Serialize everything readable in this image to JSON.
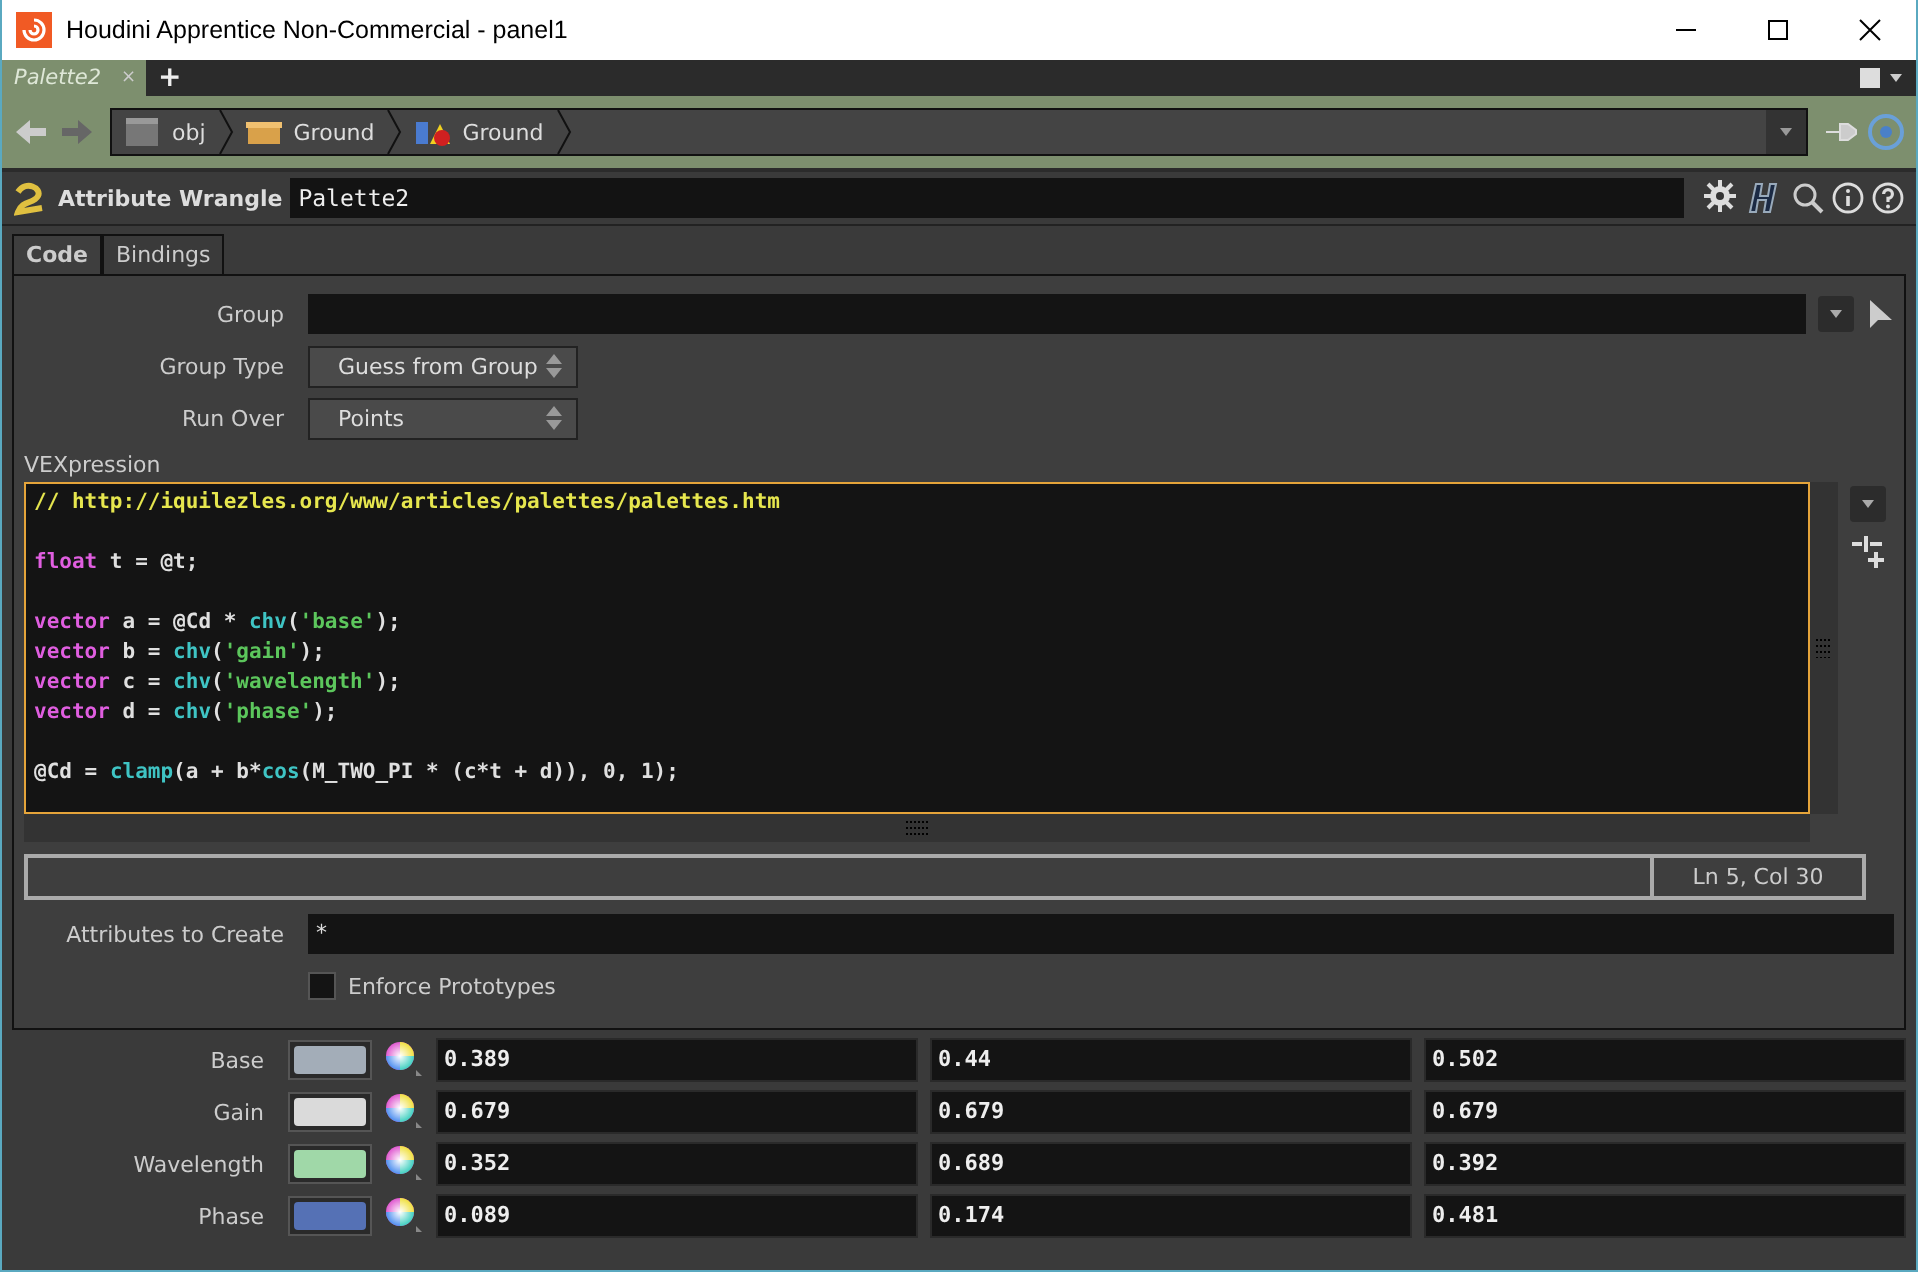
{
  "window": {
    "title": "Houdini Apprentice Non-Commercial - panel1"
  },
  "pane_tabs": [
    {
      "label": "Palette2",
      "selected": true,
      "close": "×"
    }
  ],
  "add_tab": "+",
  "path": [
    {
      "label": "obj",
      "kind": "obj"
    },
    {
      "label": "Ground",
      "kind": "geo"
    },
    {
      "label": "Ground",
      "kind": "sop"
    }
  ],
  "node": {
    "type": "Attribute Wrangle",
    "name": "Palette2"
  },
  "parm_tabs": [
    {
      "label": "Code",
      "selected": true
    },
    {
      "label": "Bindings",
      "selected": false
    }
  ],
  "group": {
    "label": "Group"
  },
  "menus": [
    {
      "label": "Group Type",
      "value": "Guess from Group"
    },
    {
      "label": "Run Over",
      "value": "Points"
    }
  ],
  "vex": {
    "label": "VEXpression",
    "lines": [
      {
        "kind": "code",
        "tokens": [
          {
            "kind": "comment",
            "text": "// http://iquilezles.org/www/articles/palettes/palettes.htm"
          }
        ]
      },
      {
        "kind": "blank"
      },
      {
        "kind": "code",
        "tokens": [
          {
            "kind": "keyword",
            "text": "float"
          },
          {
            "kind": "plain",
            "text": " t = @t;"
          }
        ]
      },
      {
        "kind": "blank"
      },
      {
        "kind": "code",
        "tokens": [
          {
            "kind": "keyword",
            "text": "vector"
          },
          {
            "kind": "plain",
            "text": " a = @Cd * "
          },
          {
            "kind": "func",
            "text": "chv"
          },
          {
            "kind": "plain",
            "text": "("
          },
          {
            "kind": "string",
            "text": "'base'"
          },
          {
            "kind": "plain",
            "text": ");"
          }
        ]
      },
      {
        "kind": "code",
        "tokens": [
          {
            "kind": "keyword",
            "text": "vector"
          },
          {
            "kind": "plain",
            "text": " b = "
          },
          {
            "kind": "func",
            "text": "chv"
          },
          {
            "kind": "plain",
            "text": "("
          },
          {
            "kind": "string",
            "text": "'gain'"
          },
          {
            "kind": "plain",
            "text": ");"
          }
        ]
      },
      {
        "kind": "code",
        "tokens": [
          {
            "kind": "keyword",
            "text": "vector"
          },
          {
            "kind": "plain",
            "text": " c = "
          },
          {
            "kind": "func",
            "text": "chv"
          },
          {
            "kind": "plain",
            "text": "("
          },
          {
            "kind": "string",
            "text": "'wavelength'"
          },
          {
            "kind": "plain",
            "text": ");"
          }
        ]
      },
      {
        "kind": "code",
        "tokens": [
          {
            "kind": "keyword",
            "text": "vector"
          },
          {
            "kind": "plain",
            "text": " d = "
          },
          {
            "kind": "func",
            "text": "chv"
          },
          {
            "kind": "plain",
            "text": "("
          },
          {
            "kind": "string",
            "text": "'phase'"
          },
          {
            "kind": "plain",
            "text": ");"
          }
        ]
      },
      {
        "kind": "blank"
      },
      {
        "kind": "code",
        "tokens": [
          {
            "kind": "plain",
            "text": "@Cd = "
          },
          {
            "kind": "func",
            "text": "clamp"
          },
          {
            "kind": "plain",
            "text": "(a + b*"
          },
          {
            "kind": "func",
            "text": "cos"
          },
          {
            "kind": "plain",
            "text": "(M_TWO_PI * (c*t + d)), 0, 1);"
          }
        ]
      }
    ],
    "status": "Ln 5, Col 30"
  },
  "attributes": {
    "label": "Attributes to Create",
    "value": "*"
  },
  "enforce": {
    "label": "Enforce Prototypes",
    "checked": false
  },
  "color_params": [
    {
      "label": "Base",
      "color": "#a3adb8",
      "values": [
        "0.389",
        "0.44",
        "0.502"
      ]
    },
    {
      "label": "Gain",
      "color": "#dadada",
      "values": [
        "0.679",
        "0.679",
        "0.679"
      ]
    },
    {
      "label": "Wavelength",
      "color": "#a0d8a8",
      "values": [
        "0.352",
        "0.689",
        "0.392"
      ]
    },
    {
      "label": "Phase",
      "color": "#5571b5",
      "values": [
        "0.089",
        "0.174",
        "0.481"
      ]
    }
  ]
}
